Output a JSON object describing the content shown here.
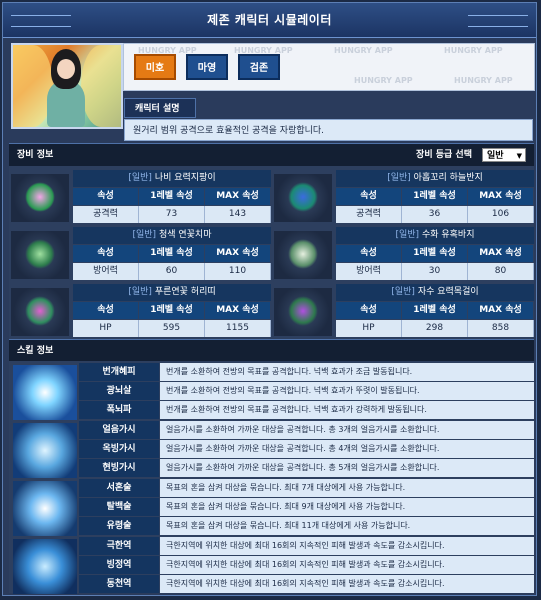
{
  "title": "제존 캐릭터 시뮬레이터",
  "watermark": "HUNGRY APP",
  "buttons": [
    {
      "label": "미호",
      "active": true
    },
    {
      "label": "마영",
      "active": false
    },
    {
      "label": "검존",
      "active": false
    }
  ],
  "description": {
    "tab": "캐릭터 설명",
    "text": "원거리 범위 공격으로 효율적인 공격을 자랑합니다."
  },
  "equipment": {
    "section_title": "장비 정보",
    "grade_label": "장비 등급 선택",
    "grade_value": "일반",
    "columns": [
      "속성",
      "1레벨 속성",
      "MAX 속성"
    ],
    "items": [
      {
        "grade": "[일반]",
        "name": "나비 요력지팡이",
        "stat": "공격력",
        "lv1": "73",
        "max": "143",
        "icon": "staff-icon"
      },
      {
        "grade": "[일반]",
        "name": "아홉꼬리 하늘반지",
        "stat": "공격력",
        "lv1": "36",
        "max": "106",
        "icon": "ring-icon"
      },
      {
        "grade": "[일반]",
        "name": "청색 연꽃치마",
        "stat": "방어력",
        "lv1": "60",
        "max": "110",
        "icon": "skirt-icon"
      },
      {
        "grade": "[일반]",
        "name": "수화 유혹바지",
        "stat": "방어력",
        "lv1": "30",
        "max": "80",
        "icon": "pants-icon"
      },
      {
        "grade": "[일반]",
        "name": "푸른연꽃 허리띠",
        "stat": "HP",
        "lv1": "595",
        "max": "1155",
        "icon": "belt-icon"
      },
      {
        "grade": "[일반]",
        "name": "자수 요력목걸이",
        "stat": "HP",
        "lv1": "298",
        "max": "858",
        "icon": "necklace-icon"
      }
    ]
  },
  "skills": {
    "section_title": "스킬 정보",
    "groups": [
      {
        "icon": "lightning-skill-icon",
        "rows": [
          {
            "name": "번개혜피",
            "desc": "번개를 소환하여 전방의 목표를 공격합니다. 넉백 효과가 조금 발동됩니다."
          },
          {
            "name": "광뇌살",
            "desc": "번개를 소환하여 전방의 목표를 공격합니다. 넉백 효과가 뚜렷이 발동됩니다."
          },
          {
            "name": "폭뇌파",
            "desc": "번개를 소환하여 전방의 목표를 공격합니다. 넉백 효과가 강력하게 발동됩니다."
          }
        ]
      },
      {
        "icon": "ice-skill-icon",
        "rows": [
          {
            "name": "얼음가시",
            "desc": "얼음가시를 소환하여 가까운 대상을 공격합니다. 총 3개의 얼음가시를 소환합니다."
          },
          {
            "name": "옥빙가시",
            "desc": "얼음가시를 소환하여 가까운 대상을 공격합니다. 총 4개의 얼음가시를 소환합니다."
          },
          {
            "name": "현빙가시",
            "desc": "얼음가시를 소환하여 가까운 대상을 공격합니다. 총 5개의 얼음가시를 소환합니다."
          }
        ]
      },
      {
        "icon": "soul-skill-icon",
        "rows": [
          {
            "name": "서혼술",
            "desc": "목표의 혼을 삼켜 대상을 묶습니다. 최대 7개 대상에게 사용 가능합니다."
          },
          {
            "name": "탈백술",
            "desc": "목표의 혼을 삼켜 대상을 묶습니다. 최대 9개 대상에게 사용 가능합니다."
          },
          {
            "name": "유령술",
            "desc": "목표의 혼을 삼켜 대상을 묶습니다. 최대 11개 대상에게 사용 가능합니다."
          }
        ]
      },
      {
        "icon": "frost-area-skill-icon",
        "rows": [
          {
            "name": "극한역",
            "desc": "극한지역에 위치한 대상에 최대 16회의 지속적인 피해 발생과 속도를 감소시킵니다."
          },
          {
            "name": "빙정역",
            "desc": "극한지역에 위치한 대상에 최대 16회의 지속적인 피해 발생과 속도를 감소시킵니다."
          },
          {
            "name": "동천역",
            "desc": "극한지역에 위치한 대상에 최대 16회의 지속적인 피해 발생과 속도를 감소시킵니다."
          }
        ]
      }
    ]
  },
  "colors": {
    "active_button": "#e57a14",
    "inactive_button": "#1f4f8f",
    "header_bar": "#131f33",
    "cell_bg": "#dbe8f5"
  }
}
